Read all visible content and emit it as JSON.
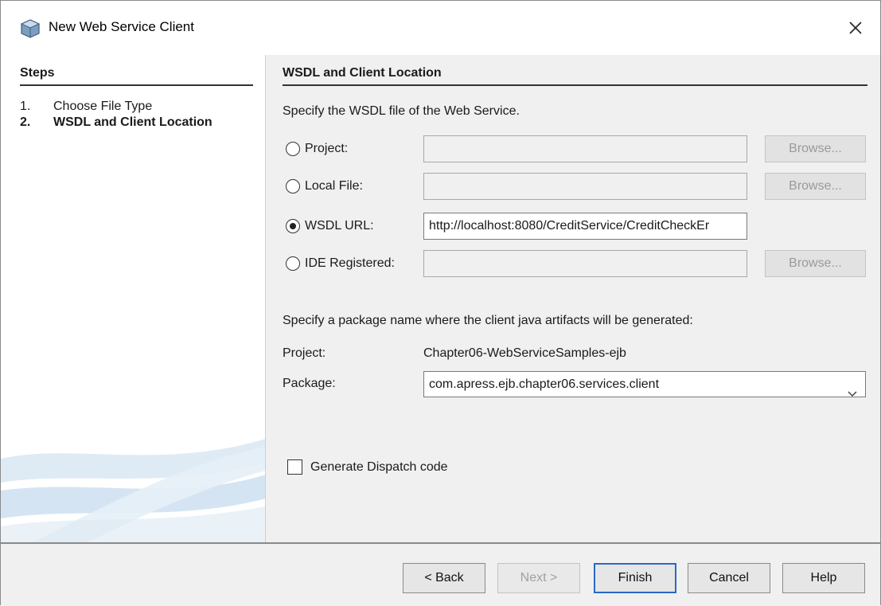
{
  "window": {
    "title": "New Web Service Client"
  },
  "sidebar": {
    "heading": "Steps",
    "steps": [
      {
        "num": "1.",
        "label": "Choose File Type",
        "current": false
      },
      {
        "num": "2.",
        "label": "WSDL and Client Location",
        "current": true
      }
    ]
  },
  "main": {
    "section_title": "WSDL and Client Location",
    "wsdl_description": "Specify the WSDL file of the Web Service.",
    "sources": [
      {
        "label": "Project:",
        "value": "",
        "selected": false,
        "browse_label": "Browse...",
        "has_browse": true
      },
      {
        "label": "Local File:",
        "value": "",
        "selected": false,
        "browse_label": "Browse...",
        "has_browse": true
      },
      {
        "label": "WSDL URL:",
        "value": "http://localhost:8080/CreditService/CreditCheckEr",
        "selected": true,
        "has_browse": false
      },
      {
        "label": "IDE Registered:",
        "value": "",
        "selected": false,
        "browse_label": "Browse...",
        "has_browse": true
      }
    ],
    "package_description": "Specify a package name where the client java artifacts will be generated:",
    "project_label": "Project:",
    "project_value": "Chapter06-WebServiceSamples-ejb",
    "package_label": "Package:",
    "package_value": "com.apress.ejb.chapter06.services.client",
    "dispatch_label": "Generate Dispatch code",
    "dispatch_checked": false
  },
  "footer": {
    "back_label": "< Back",
    "next_label": "Next >",
    "finish_label": "Finish",
    "cancel_label": "Cancel",
    "help_label": "Help"
  },
  "icons": {
    "app": "netbeans-cube-icon",
    "close": "close-icon",
    "dropdown": "chevron-down-icon"
  },
  "colors": {
    "dialog_bg": "#f0f0f0",
    "sidebar_bg": "#ffffff",
    "default_button_border": "#2b68c4",
    "disabled_text": "#9a9a9a"
  }
}
